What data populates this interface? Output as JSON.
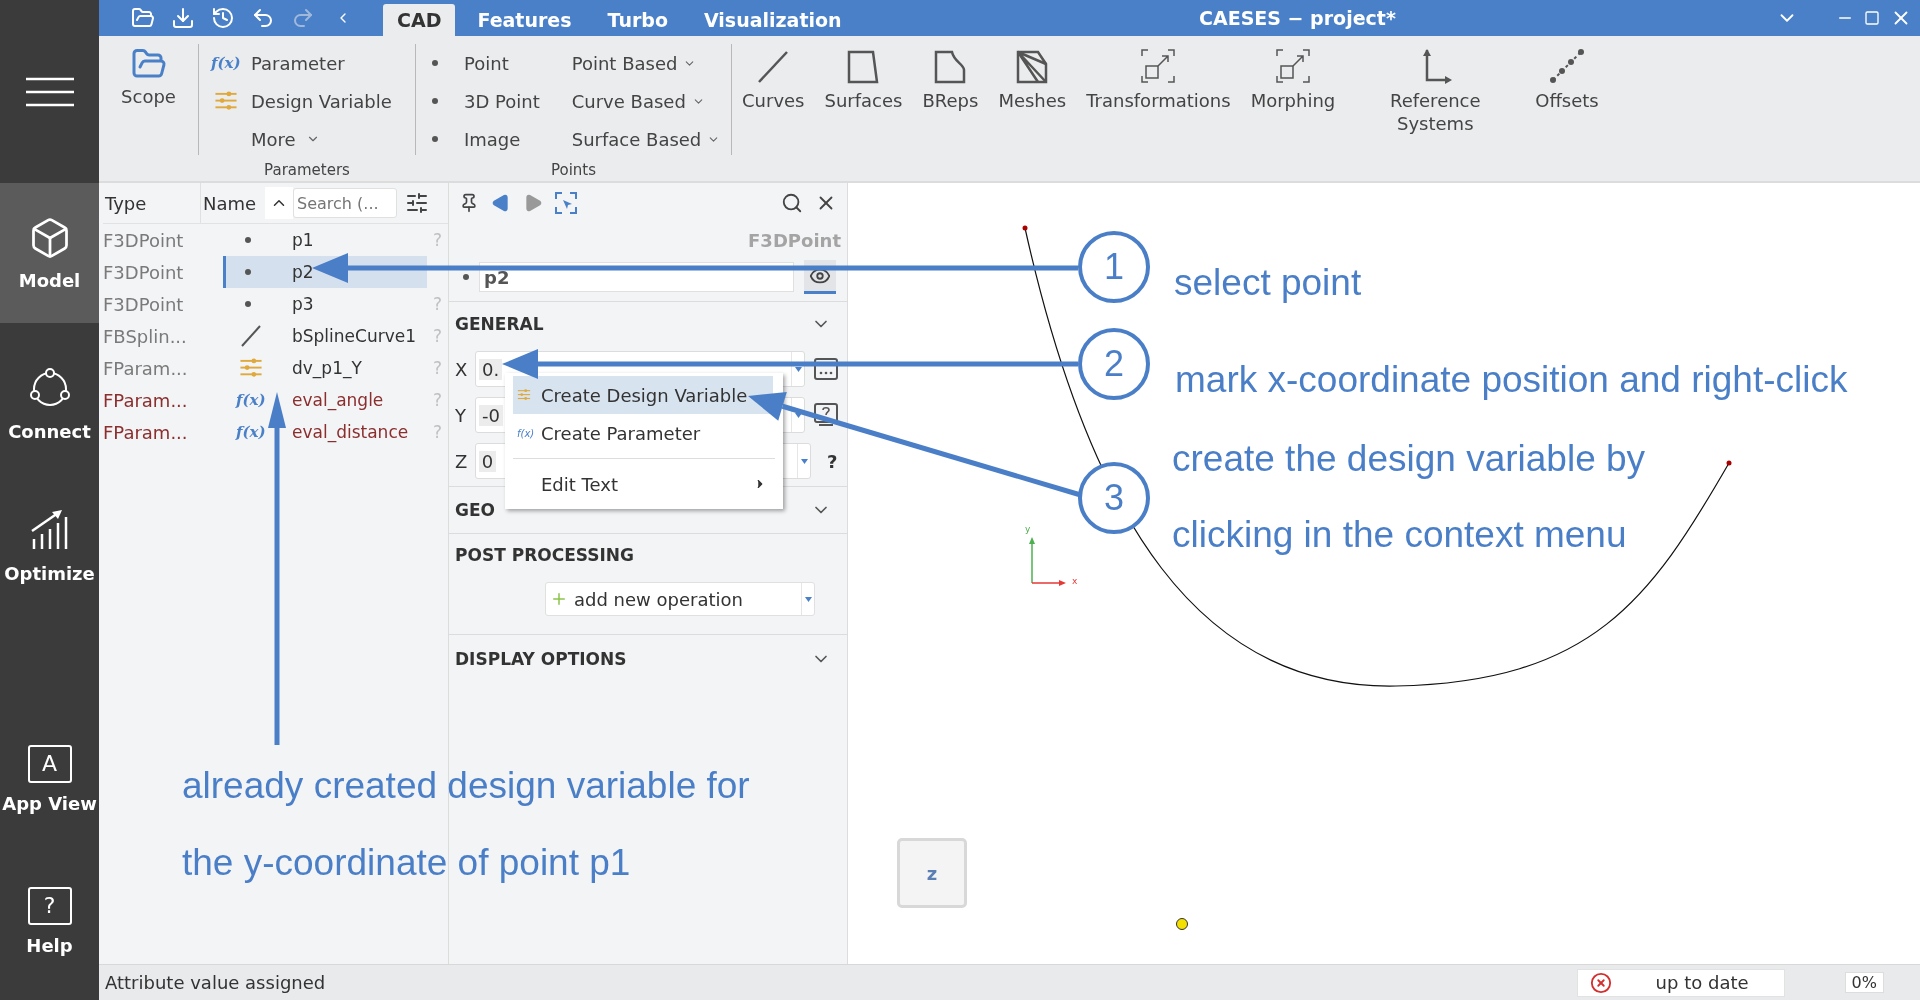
{
  "sidebar": {
    "items": [
      {
        "label": "Model",
        "selected": true
      },
      {
        "label": "Connect",
        "selected": false
      },
      {
        "label": "Optimize",
        "selected": false
      },
      {
        "label": "App View",
        "selected": false,
        "icon_text": "A"
      },
      {
        "label": "Help",
        "selected": false,
        "icon_text": "?"
      }
    ]
  },
  "title_bar": {
    "tabs": [
      {
        "label": "CAD",
        "selected": true
      },
      {
        "label": "Features",
        "selected": false
      },
      {
        "label": "Turbo",
        "selected": false
      },
      {
        "label": "Visualization",
        "selected": false
      }
    ],
    "title": "CAESES − project*"
  },
  "ribbon": {
    "scope": "Scope",
    "parameters": {
      "label": "Parameters",
      "items": [
        {
          "label": "Parameter",
          "kind": "parameter",
          "icon_text": "f(x)"
        },
        {
          "label": "Design Variable",
          "kind": "design_variable"
        },
        {
          "label": "More",
          "kind": "menu"
        }
      ]
    },
    "points": {
      "label": "Points",
      "items": [
        "Point",
        "3D Point",
        "Image"
      ],
      "menus": [
        "Point Based",
        "Curve Based",
        "Surface Based"
      ]
    },
    "tools": [
      "Curves",
      "Surfaces",
      "BReps",
      "Meshes",
      "Transformations",
      "Morphing",
      "Reference Systems",
      "Offsets"
    ]
  },
  "tree": {
    "columns": [
      "Type",
      "Name"
    ],
    "search": {
      "placeholder": "Search (..."
    },
    "rows": [
      {
        "type": "F3DPoint",
        "name": "p1",
        "kind": "point",
        "selected": false,
        "flagged": false,
        "status": "?"
      },
      {
        "type": "F3DPoint",
        "name": "p2",
        "kind": "point",
        "selected": true,
        "flagged": false
      },
      {
        "type": "F3DPoint",
        "name": "p3",
        "kind": "point",
        "selected": false,
        "flagged": false,
        "status": "?"
      },
      {
        "type": "FBSplin...",
        "name": "bSplineCurve1",
        "kind": "curve",
        "selected": false,
        "flagged": false,
        "status": "?"
      },
      {
        "type": "FParam...",
        "name": "dv_p1_Y",
        "kind": "design_variable",
        "selected": false,
        "flagged": false,
        "status": "?"
      },
      {
        "type": "FParam...",
        "name": "eval_angle",
        "kind": "parameter",
        "icon_text": "f(x)",
        "selected": false,
        "flagged": true,
        "status": "?"
      },
      {
        "type": "FParam...",
        "name": "eval_distance",
        "kind": "parameter",
        "icon_text": "f(x)",
        "selected": false,
        "flagged": true,
        "status": "?"
      }
    ]
  },
  "properties": {
    "type_label": "F3DPoint",
    "name": "p2",
    "general": {
      "title": "GENERAL",
      "fields": [
        {
          "label": "X",
          "value": "0.",
          "kind": "dots"
        },
        {
          "label": "Y",
          "value": "-0",
          "kind": "help_box"
        },
        {
          "label": "Z",
          "value": "0",
          "kind": "help",
          "help": "?"
        }
      ]
    },
    "geometry": {
      "title": "GEO"
    },
    "post_processing": {
      "title": "POST PROCESSING",
      "button": "add new operation"
    },
    "display_options": {
      "title": "DISPLAY OPTIONS"
    }
  },
  "context_menu": {
    "items": [
      {
        "label": "Create Design Variable",
        "kind": "design_variable",
        "selected": true
      },
      {
        "label": "Create Parameter",
        "kind": "parameter",
        "icon_text": "f(x)",
        "selected": false
      },
      {
        "label": "Edit Text",
        "kind": "submenu",
        "selected": false
      }
    ]
  },
  "viewport": {
    "axes": {
      "x": "x",
      "y": "y"
    },
    "view_cube": "z"
  },
  "annotations": [
    {
      "number": "1",
      "text": "select point"
    },
    {
      "number": "2",
      "text": "mark x-coordinate position and right-click"
    },
    {
      "number": "3",
      "text": "create the design variable by clicking in the context menu"
    }
  ],
  "note": {
    "text": "already created design variable for the y-coordinate of point p1"
  },
  "status_bar": {
    "message": "Attribute value assigned",
    "state": "up to date",
    "progress": "0%"
  }
}
